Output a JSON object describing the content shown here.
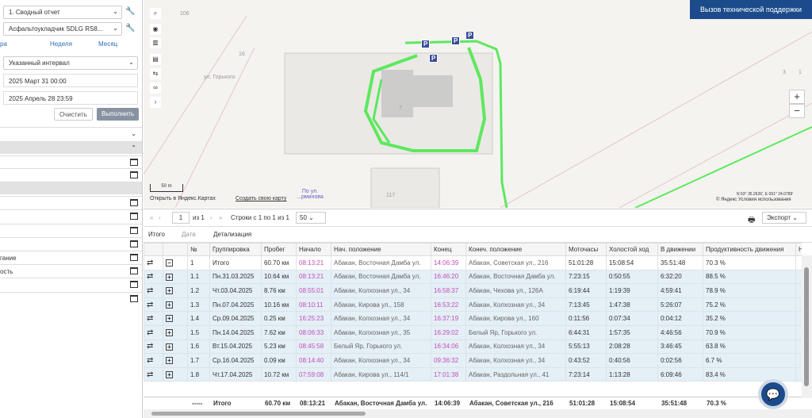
{
  "left": {
    "report": "1. Сводный отчет",
    "unit": "Асфальтоукладчик SDLG RS8...",
    "periods": [
      "ра",
      "Неделя",
      "Месяц"
    ],
    "interval": "Указанный интервал",
    "from": "2025 Март 31 00:00",
    "to": "2025 Апрель 28 23:59",
    "clear": "Очистить",
    "run": "Выполнить",
    "rows": [
      "",
      "",
      "",
      "",
      "",
      "",
      "",
      "",
      "гание",
      "ость",
      "",
      ""
    ]
  },
  "map": {
    "support": "Вызов технической поддержки",
    "zoom_in": "+",
    "zoom_out": "−",
    "scale": "50 m",
    "open_yandex": "Открыть в Яндекс.Картах",
    "create_map": "Создать свою карту",
    "poi": "По ул. ...рминова",
    "copyright": "© Яндекс Условия использования",
    "coords": "N 53° 35.2626', E 091° 24.0789'",
    "street": "ул. Горького",
    "labels": [
      "106",
      "102",
      "16",
      "15",
      "17",
      "7",
      "3",
      "1",
      "117",
      "8",
      "9",
      "10",
      "11",
      "12",
      "13",
      "14"
    ]
  },
  "pager": {
    "page": "1",
    "of": "из 1",
    "rows_info": "Строки с 1 по 1 из 1",
    "per_page": "50",
    "export": "Экспорт"
  },
  "tabs": [
    "Итого",
    "Дата",
    "Детализация"
  ],
  "table": {
    "headers": [
      "",
      "",
      "№",
      "Группировка",
      "Пробег",
      "Начало",
      "Нач. положение",
      "Конец",
      "Конеч. положение",
      "Моточасы",
      "Холостой ход",
      "В движении",
      "Продуктивность движения",
      "Нач"
    ],
    "rows": [
      {
        "n": "1",
        "group": "Итого",
        "mileage": "60.70 км",
        "start": "08:13:21",
        "start_pos": "Абакан, Восточная Дамба ул.",
        "end": "14:06:39",
        "end_pos": "Абакан, Советская ул., 216",
        "engine": "51:01:28",
        "idle": "15:08:54",
        "moving": "35:51:48",
        "prod": "70.3 %",
        "sym": "−"
      },
      {
        "n": "1.1",
        "group": "Пн.31.03.2025",
        "mileage": "10.64 км",
        "start": "08:13:21",
        "start_pos": "Абакан, Восточная Дамба ул.",
        "end": "16:46:20",
        "end_pos": "Абакан, Восточная Дамба ул.",
        "engine": "7:23:15",
        "idle": "0:50:55",
        "moving": "6:32:20",
        "prod": "88.5 %",
        "sym": "+"
      },
      {
        "n": "1.2",
        "group": "Чт.03.04.2025",
        "mileage": "8.76 км",
        "start": "08:55:01",
        "start_pos": "Абакан, Колхозная ул., 34",
        "end": "16:58:37",
        "end_pos": "Абакан, Чехова ул., 126А",
        "engine": "6:19:44",
        "idle": "1:19:39",
        "moving": "4:59:41",
        "prod": "78.9 %",
        "sym": "+"
      },
      {
        "n": "1.3",
        "group": "Пн.07.04.2025",
        "mileage": "10.16 км",
        "start": "08:10:11",
        "start_pos": "Абакан, Кирова ул., 158",
        "end": "16:53:22",
        "end_pos": "Абакан, Колхозная ул., 34",
        "engine": "7:13:45",
        "idle": "1:47:38",
        "moving": "5:26:07",
        "prod": "75.2 %",
        "sym": "+"
      },
      {
        "n": "1.4",
        "group": "Ср.09.04.2025",
        "mileage": "0.25 км",
        "start": "16:25:23",
        "start_pos": "Абакан, Колхозная ул., 34",
        "end": "16:37:19",
        "end_pos": "Абакан, Кирова ул., 160",
        "engine": "0:11:56",
        "idle": "0:07:34",
        "moving": "0:04:12",
        "prod": "35.2 %",
        "sym": "+"
      },
      {
        "n": "1.5",
        "group": "Пн.14.04.2025",
        "mileage": "7.62 км",
        "start": "08:06:33",
        "start_pos": "Абакан, Колхозная ул., 35",
        "end": "16:29:02",
        "end_pos": "Белый Яр, Горького ул.",
        "engine": "6:44:31",
        "idle": "1:57:35",
        "moving": "4:46:56",
        "prod": "70.9 %",
        "sym": "+"
      },
      {
        "n": "1.6",
        "group": "Вт.15.04.2025",
        "mileage": "5.23 км",
        "start": "08:45:58",
        "start_pos": "Белый Яр, Горького ул.",
        "end": "16:34:06",
        "end_pos": "Абакан, Колхозная ул., 34",
        "engine": "5:55:13",
        "idle": "2:08:28",
        "moving": "3:46:45",
        "prod": "63.8 %",
        "sym": "+"
      },
      {
        "n": "1.7",
        "group": "Ср.16.04.2025",
        "mileage": "0.09 км",
        "start": "08:14:40",
        "start_pos": "Абакан, Колхозная ул., 34",
        "end": "09:36:32",
        "end_pos": "Абакан, Колхозная ул., 34",
        "engine": "0:43:52",
        "idle": "0:40:56",
        "moving": "0:02:56",
        "prod": "6.7 %",
        "sym": "+"
      },
      {
        "n": "1.8",
        "group": "Чт.17.04.2025",
        "mileage": "10.72 км",
        "start": "07:59:08",
        "start_pos": "Абакан, Кирова ул., 114/1",
        "end": "17:01:38",
        "end_pos": "Абакан, Раздольная ул., 41",
        "engine": "7:23:14",
        "idle": "1:13:28",
        "moving": "6:09:46",
        "prod": "83.4 %",
        "sym": "+"
      }
    ],
    "footer": {
      "dash": "-----",
      "group": "Итого",
      "mileage": "60.70 км",
      "start": "08:13:21",
      "start_pos": "Абакан, Восточная Дамба ул.",
      "end": "14:06:39",
      "end_pos": "Абакан, Советская ул., 216",
      "engine": "51:01:28",
      "idle": "15:08:54",
      "moving": "35:51:48",
      "prod": "70.3 %"
    }
  },
  "colors": {
    "accent": "#1c4b8c",
    "track": "#5ee85e",
    "time": "#c24dbc"
  }
}
